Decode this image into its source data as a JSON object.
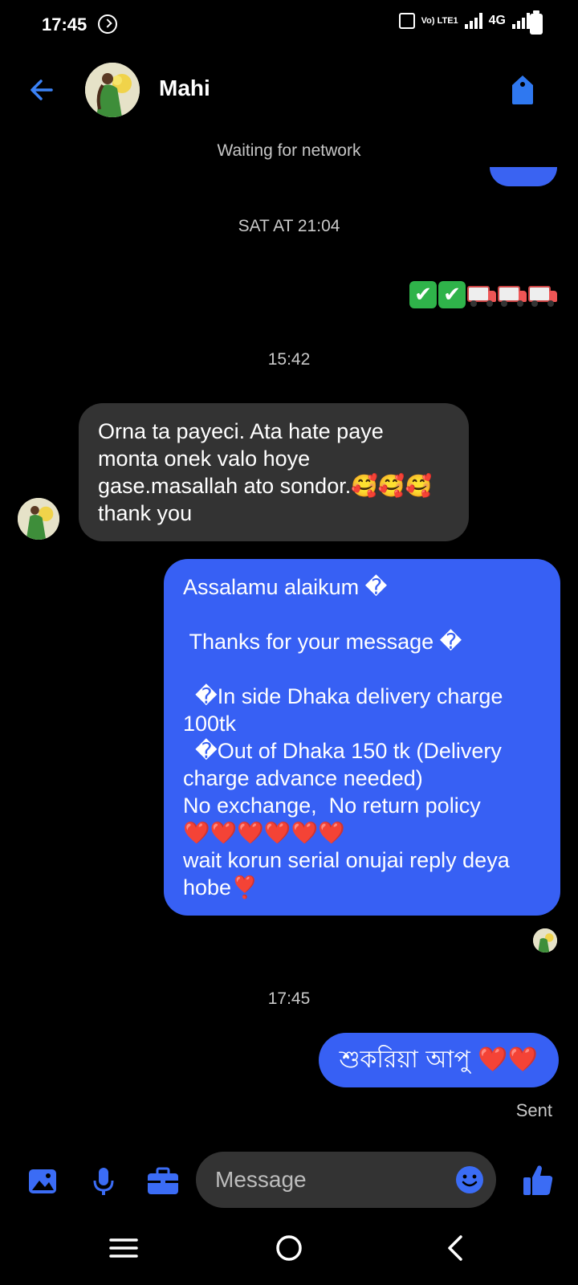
{
  "status_bar": {
    "time": "17:45",
    "network": "4G",
    "volte": "Vo) LTE1"
  },
  "header": {
    "back_icon": "arrow-left-icon",
    "contact_name": "Mahi",
    "action_icon": "tag-icon"
  },
  "network_status": "Waiting for network",
  "messages": {
    "ts1": "SAT AT 21:04",
    "emoji_message": {
      "checks": [
        "✔",
        "✔"
      ],
      "trucks": 3
    },
    "ts2": "15:42",
    "incoming_1": "Orna ta payeci. Ata hate paye monta onek valo hoye gase.masallah ato sondor.🥰🥰🥰thank you",
    "outgoing_1": "Assalamu alaikum �\n\n Thanks for your message �\n\n  �In side Dhaka delivery charge 100tk\n  �Out of Dhaka 150 tk (Delivery charge advance needed)\nNo exchange,  No return policy\n❤️❤️❤️❤️❤️❤️\nwait korun serial onujai reply deya hobe❣️",
    "ts3": "17:45",
    "outgoing_2": "শুকরিয়া আপু ❤️❤️",
    "sent_label": "Sent"
  },
  "composer": {
    "placeholder": "Message",
    "icons": [
      "image-icon",
      "microphone-icon",
      "briefcase-icon",
      "emoji-icon",
      "thumbs-up-icon"
    ]
  },
  "colors": {
    "accent": "#3760f4",
    "incoming_bubble": "#333333",
    "background": "#000000"
  }
}
